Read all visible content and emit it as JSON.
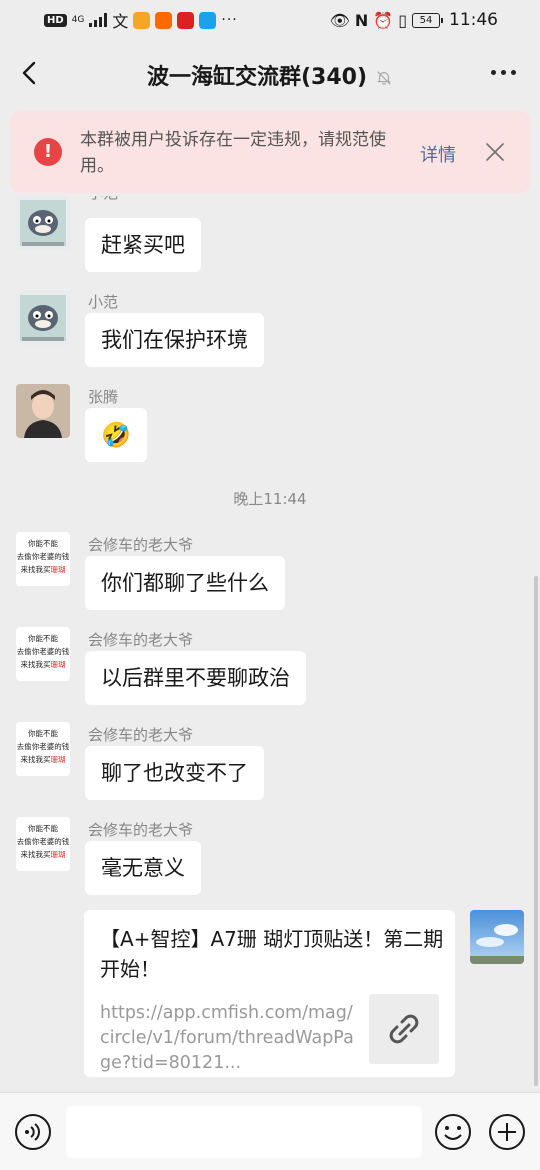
{
  "status_bar": {
    "badge": "HD",
    "network": "4G",
    "battery": "54",
    "time": "11:46"
  },
  "header": {
    "title": "波一海缸交流群(340)"
  },
  "warning": {
    "text": "本群被用户投诉存在一定违规，请规范使用。",
    "detail_label": "详情"
  },
  "avatar_text": {
    "line1": "你能不能",
    "line2": "去偷你老婆的钱",
    "line3_prefix": "来找我买",
    "line3_highlight": "珊瑚"
  },
  "messages": [
    {
      "sender": "小范",
      "text": "赶紧买吧"
    },
    {
      "sender": "小范",
      "text": "我们在保护环境"
    },
    {
      "sender": "张腾",
      "emoji": "🤣"
    },
    {
      "sender": "会修车的老大爷",
      "text": "你们都聊了些什么"
    },
    {
      "sender": "会修车的老大爷",
      "text": "以后群里不要聊政治"
    },
    {
      "sender": "会修车的老大爷",
      "text": "聊了也改变不了"
    },
    {
      "sender": "会修车的老大爷",
      "text": "毫无意义"
    }
  ],
  "time_divider": "晚上11:44",
  "link_card": {
    "title": "【A+智控】A7珊 瑚灯顶贴送！第二期开始！",
    "url": "https://app.cmfish.com/mag/circle/v1/forum/threadWapPage?tid=80121..."
  },
  "icons": {
    "back": "back-arrow-icon",
    "mute": "bell-off-icon",
    "more": "more-dots-icon",
    "warning": "warning-icon",
    "close": "close-icon",
    "link": "link-icon",
    "voice": "voice-icon",
    "emoji": "emoji-icon",
    "plus": "plus-icon"
  },
  "colors": {
    "background": "#ededed",
    "warning_bg": "#fbe3e3",
    "warning_icon": "#e54545",
    "link_blue": "#576b95"
  }
}
